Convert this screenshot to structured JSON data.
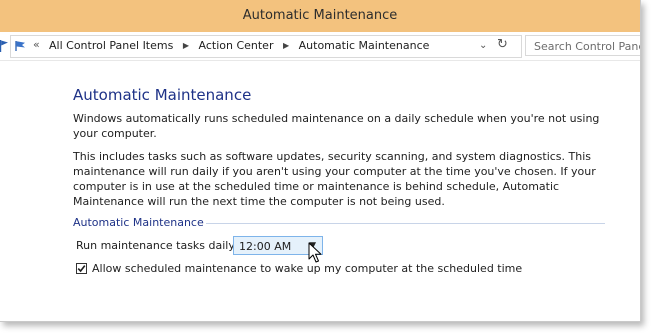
{
  "window": {
    "title": "Automatic Maintenance",
    "titlebar_color": "#f3c27e"
  },
  "address": {
    "crumbs": [
      "All Control Panel Items",
      "Action Center",
      "Automatic Maintenance"
    ],
    "back_chevron": "«",
    "search_placeholder": "Search Control Panel"
  },
  "icons": {
    "flag": "flag-icon",
    "address": "control-panel-icon",
    "dropdown": "chevron-down-icon",
    "refresh": "refresh-icon",
    "cursor": "mouse-cursor-icon"
  },
  "main": {
    "heading": "Automatic Maintenance",
    "desc1": "Windows automatically runs scheduled maintenance on a daily schedule when you're not using your computer.",
    "desc2": "This includes tasks such as software updates, security scanning, and system diagnostics. This maintenance will run daily if you aren't using your computer at the time you've chosen. If your computer is in use at the scheduled time or maintenance is behind schedule, Automatic Maintenance will run the next time the computer is not being used.",
    "section_label": "Automatic Maintenance",
    "run_label": "Run maintenance tasks daily at",
    "time_value": "12:00 AM",
    "wake_label": "Allow scheduled maintenance to wake up my computer at the scheduled time",
    "wake_checked": true
  },
  "colors": {
    "heading": "#1e3287",
    "select_border": "#7eb4ea",
    "select_bg": "#e5f1fb"
  }
}
